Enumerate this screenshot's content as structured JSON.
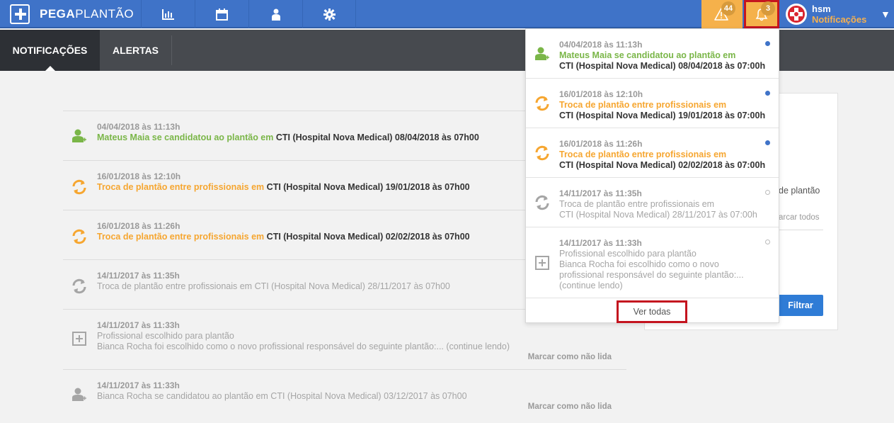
{
  "app": {
    "brand_left": "PEGA",
    "brand_right": "PLANTÃO"
  },
  "topbar": {
    "nav_icons": [
      "chart-icon",
      "calendar-icon",
      "user-icon",
      "gear-icon"
    ],
    "alerts_count": "44",
    "notifications_count": "3",
    "user_name": "hsm",
    "user_sub": "Notificações",
    "caret": "▼"
  },
  "tabs": [
    {
      "label": "NOTIFICAÇÕES",
      "active": true
    },
    {
      "label": "ALERTAS",
      "active": false
    }
  ],
  "list": [
    {
      "date": "04/04/2018 às 11:13h",
      "title": "Mateus Maia se candidatou ao plantão em",
      "detail": " CTI (Hospital Nova Medical) 08/04/2018 às 07h00",
      "icon": "user-add-icon",
      "style": "green",
      "mark": ""
    },
    {
      "date": "16/01/2018 às 12:10h",
      "title": "Troca de plantão entre profissionais em",
      "detail": " CTI (Hospital Nova Medical) 19/01/2018 às 07h00",
      "icon": "swap-icon",
      "style": "orange",
      "mark": ""
    },
    {
      "date": "16/01/2018 às 11:26h",
      "title": "Troca de plantão entre profissionais em",
      "detail": " CTI (Hospital Nova Medical) 02/02/2018 às 07h00",
      "icon": "swap-icon",
      "style": "orange",
      "mark": ""
    },
    {
      "date": "14/11/2017 às 11:35h",
      "title": "Troca de plantão entre profissionais em CTI (Hospital Nova Medical) 28/11/2017 às 07h00",
      "detail": "",
      "icon": "swap-icon",
      "style": "read",
      "mark": ""
    },
    {
      "date": "14/11/2017 às 11:33h",
      "title": "Profissional escolhido para plantão",
      "detail": "Bianca Rocha foi escolhido como o novo profissional responsável do seguinte plantão:... (continue lendo)",
      "icon": "plus-box-icon",
      "style": "read",
      "mark": "Marcar como não lida"
    },
    {
      "date": "14/11/2017 às 11:33h",
      "title": "Bianca Rocha se candidatou ao plantão em CTI (Hospital Nova Medical) 03/12/2017 às 07h00",
      "detail": "",
      "icon": "user-add-icon",
      "style": "read",
      "mark": "Marcar como não lida"
    }
  ],
  "filter": {
    "partial_text": "de plantão",
    "mark_all": "arcar todos",
    "button": "Filtrar"
  },
  "dropdown": {
    "items": [
      {
        "date": "04/04/2018 às 11:13h",
        "l1": "Mateus Maia se candidatou ao plantão em",
        "l2": "CTI (Hospital Nova Medical) 08/04/2018 às 07:00h",
        "l3": "",
        "l4": "",
        "icon": "user-add-icon",
        "style": "green",
        "unread": true
      },
      {
        "date": "16/01/2018 às 12:10h",
        "l1": "Troca de plantão entre profissionais em",
        "l2": "CTI (Hospital Nova Medical) 19/01/2018 às 07:00h",
        "l3": "",
        "l4": "",
        "icon": "swap-icon",
        "style": "orange",
        "unread": true
      },
      {
        "date": "16/01/2018 às 11:26h",
        "l1": "Troca de plantão entre profissionais em",
        "l2": "CTI (Hospital Nova Medical) 02/02/2018 às 07:00h",
        "l3": "",
        "l4": "",
        "icon": "swap-icon",
        "style": "orange",
        "unread": true
      },
      {
        "date": "14/11/2017 às 11:35h",
        "l1": "Troca de plantão entre profissionais em",
        "l2": "CTI (Hospital Nova Medical) 28/11/2017 às 07:00h",
        "l3": "",
        "l4": "",
        "icon": "swap-icon",
        "style": "read",
        "unread": false
      },
      {
        "date": "14/11/2017 às 11:33h",
        "l1": "Profissional escolhido para plantão",
        "l2": "Bianca Rocha foi escolhido como o novo",
        "l3": "profissional responsável do seguinte plantão:...",
        "l4": "(continue lendo)",
        "icon": "plus-box-icon",
        "style": "read",
        "unread": false
      }
    ],
    "see_all": "Ver todas"
  },
  "colors": {
    "brand_blue": "#3f73c8",
    "accent_orange": "#f6a630",
    "accent_green": "#7ab648",
    "highlight_red": "#c4141f"
  }
}
